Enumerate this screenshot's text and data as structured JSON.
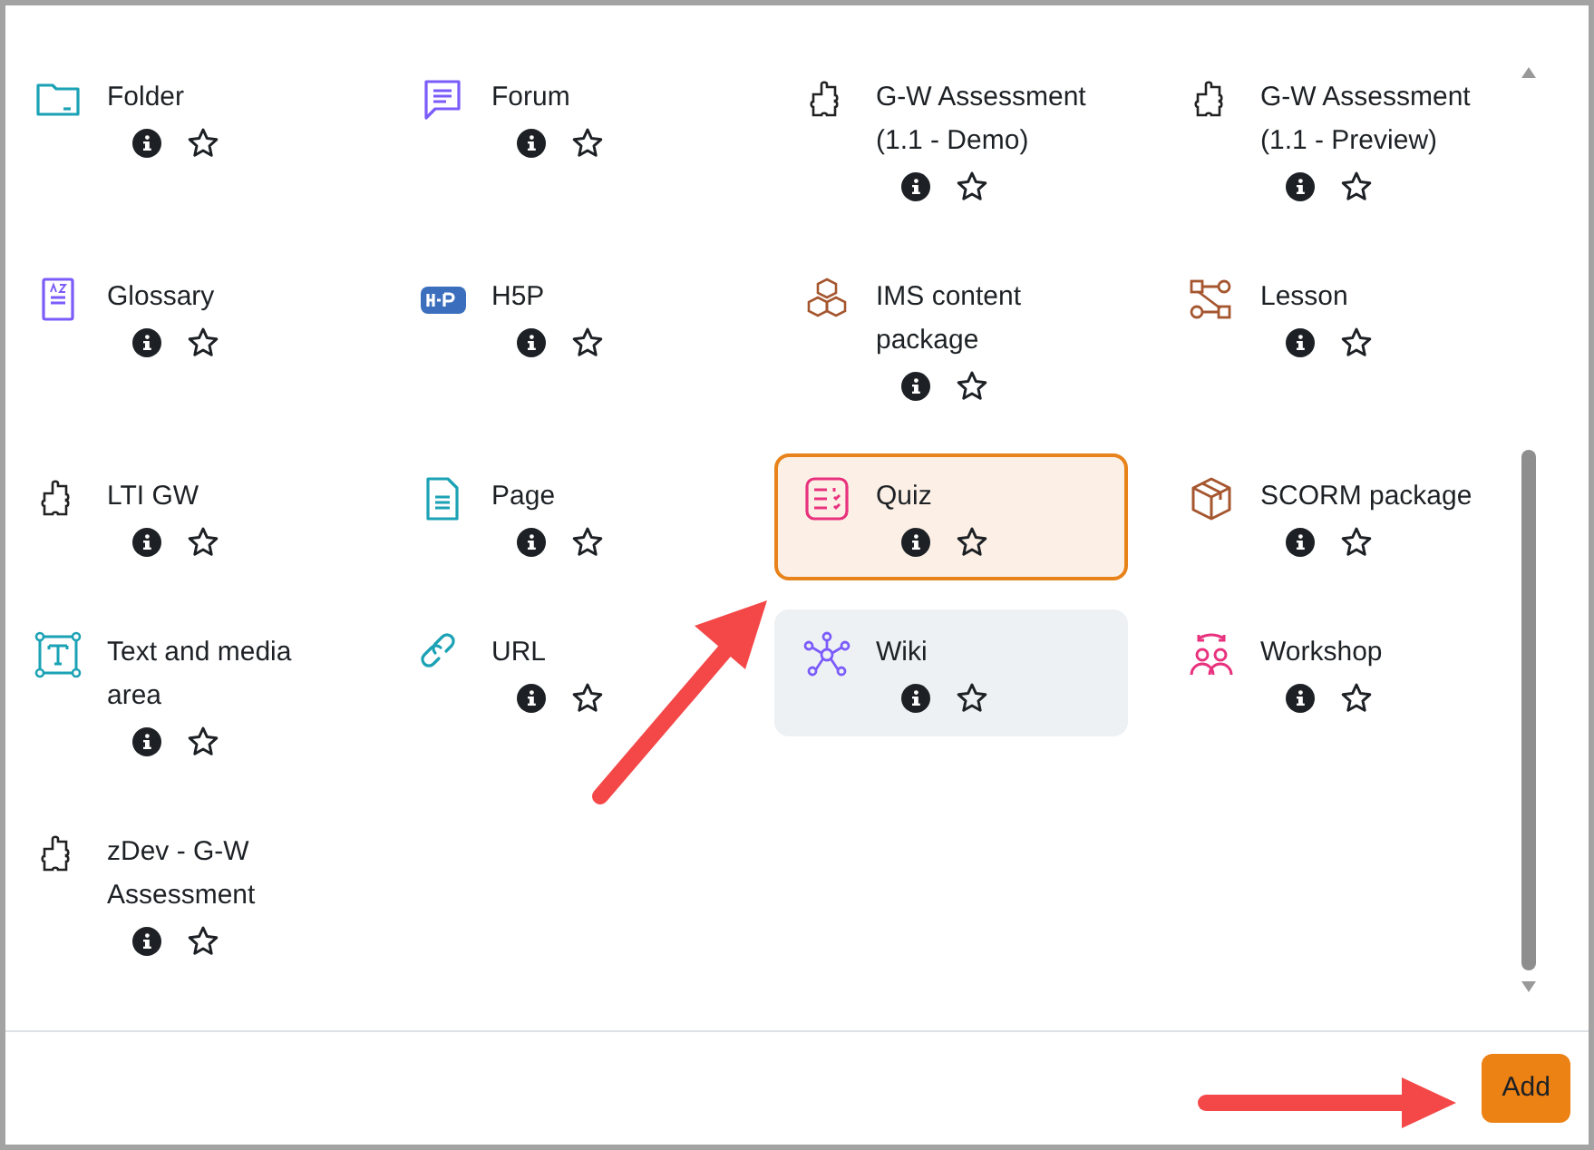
{
  "items": [
    {
      "name": "Folder",
      "kind": "folder",
      "selected": false,
      "hovered": false
    },
    {
      "name": "Forum",
      "kind": "forum",
      "selected": false,
      "hovered": false
    },
    {
      "name": "G-W Assessment (1.1 - Demo)",
      "kind": "plugin",
      "selected": false,
      "hovered": false
    },
    {
      "name": "G-W Assessment (1.1 - Preview)",
      "kind": "plugin",
      "selected": false,
      "hovered": false
    },
    {
      "name": "Glossary",
      "kind": "glossary",
      "selected": false,
      "hovered": false
    },
    {
      "name": "H5P",
      "kind": "h5p",
      "selected": false,
      "hovered": false
    },
    {
      "name": "IMS content package",
      "kind": "ims",
      "selected": false,
      "hovered": false
    },
    {
      "name": "Lesson",
      "kind": "lesson",
      "selected": false,
      "hovered": false
    },
    {
      "name": "LTI GW",
      "kind": "plugin",
      "selected": false,
      "hovered": false
    },
    {
      "name": "Page",
      "kind": "page",
      "selected": false,
      "hovered": false
    },
    {
      "name": "Quiz",
      "kind": "quiz",
      "selected": true,
      "hovered": false
    },
    {
      "name": "SCORM package",
      "kind": "scorm",
      "selected": false,
      "hovered": false
    },
    {
      "name": "Text and media area",
      "kind": "textmedia",
      "selected": false,
      "hovered": false
    },
    {
      "name": "URL",
      "kind": "url",
      "selected": false,
      "hovered": false
    },
    {
      "name": "Wiki",
      "kind": "wiki",
      "selected": false,
      "hovered": true
    },
    {
      "name": "Workshop",
      "kind": "workshop",
      "selected": false,
      "hovered": false
    },
    {
      "name": "zDev - G-W Assessment",
      "kind": "plugin",
      "selected": false,
      "hovered": false
    }
  ],
  "footer": {
    "button": "Add"
  }
}
